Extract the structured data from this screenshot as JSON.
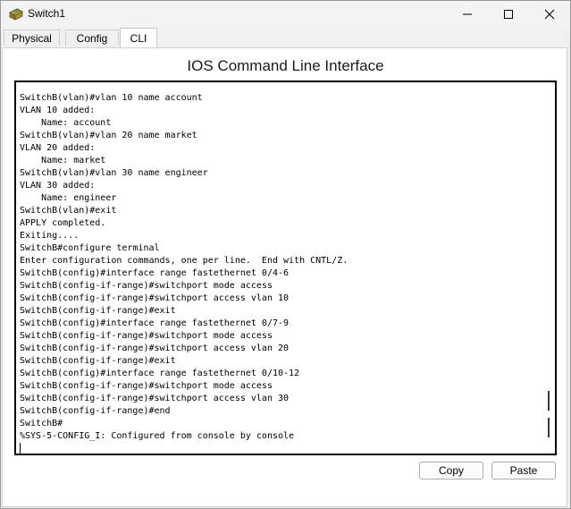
{
  "window": {
    "title": "Switch1",
    "minimize_glyph": "—",
    "maximize_glyph": "☐",
    "close_glyph": "✕"
  },
  "tabs": [
    {
      "label": "Physical",
      "active": false
    },
    {
      "label": "Config",
      "active": false
    },
    {
      "label": "CLI",
      "active": true
    }
  ],
  "panel": {
    "title": "IOS Command Line Interface"
  },
  "console": {
    "lines": [
      "SwitchB(vlan)#vlan 10 name account",
      "VLAN 10 added:",
      "    Name: account",
      "SwitchB(vlan)#vlan 20 name market",
      "VLAN 20 added:",
      "    Name: market",
      "SwitchB(vlan)#vlan 30 name engineer",
      "VLAN 30 added:",
      "    Name: engineer",
      "SwitchB(vlan)#exit",
      "APPLY completed.",
      "Exiting....",
      "SwitchB#configure terminal",
      "Enter configuration commands, one per line.  End with CNTL/Z.",
      "SwitchB(config)#interface range fastethernet 0/4-6",
      "SwitchB(config-if-range)#switchport mode access",
      "SwitchB(config-if-range)#switchport access vlan 10",
      "SwitchB(config-if-range)#exit",
      "SwitchB(config)#interface range fastethernet 0/7-9",
      "SwitchB(config-if-range)#switchport mode access",
      "SwitchB(config-if-range)#switchport access vlan 20",
      "SwitchB(config-if-range)#exit",
      "SwitchB(config)#interface range fastethernet 0/10-12",
      "SwitchB(config-if-range)#switchport mode access",
      "SwitchB(config-if-range)#switchport access vlan 30",
      "SwitchB(config-if-range)#end",
      "SwitchB#",
      "%SYS-5-CONFIG_I: Configured from console by console"
    ]
  },
  "buttons": {
    "copy": "Copy",
    "paste": "Paste"
  },
  "icons": {
    "app": "switch-device-icon",
    "minimize": "minimize-icon",
    "maximize": "maximize-icon",
    "close": "close-icon"
  }
}
